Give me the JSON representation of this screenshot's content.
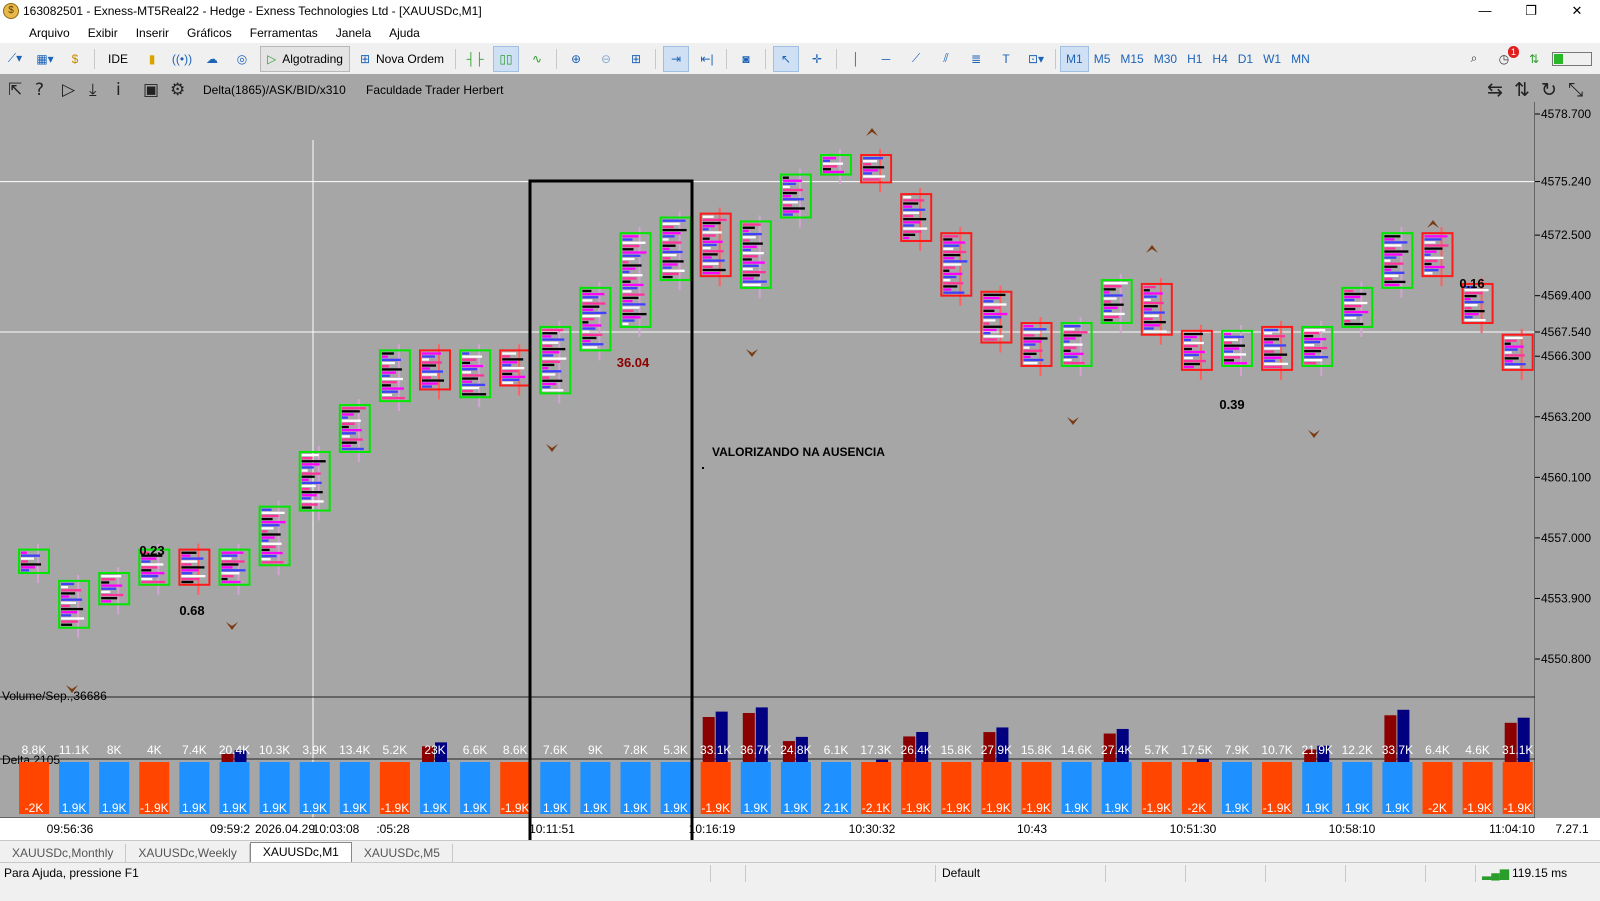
{
  "window": {
    "title": "163082501 - Exness-MT5Real22 - Hedge - Exness Technologies Ltd - [XAUUSDc,M1]",
    "min": "—",
    "max": "❐",
    "close": "✕"
  },
  "menu": [
    "Arquivo",
    "Exibir",
    "Inserir",
    "Gráficos",
    "Ferramentas",
    "Janela",
    "Ajuda"
  ],
  "toolbar": {
    "ide": "IDE",
    "algotrading": "Algotrading",
    "nova_ordem": "Nova Ordem",
    "timeframes": [
      "M1",
      "M5",
      "M15",
      "M30",
      "H1",
      "H4",
      "D1",
      "W1",
      "MN"
    ],
    "active_timeframe": "M1",
    "notif_count": "1"
  },
  "chart": {
    "indicator_label": "Delta(1865)/ASK/BID/x310",
    "owner_label": "Faculdade Trader Herbert",
    "prices": [
      "4578.700",
      "4575.240",
      "4572.500",
      "4569.400",
      "4567.540",
      "4566.300",
      "4563.200",
      "4560.100",
      "4557.000",
      "4553.900",
      "4550.800"
    ],
    "annotation": "VALORIZANDO NA AUSENCIA",
    "small_values": [
      "0.23",
      "0.68",
      "36.04",
      "0.39",
      "0.16"
    ],
    "volume_label": "Volume/Sep.,36686",
    "delta_label": "Delta,2105",
    "volume_values": [
      "8.8K",
      "11.1K",
      "8K",
      "4K",
      "7.4K",
      "20.4K",
      "10.3K",
      "3.9K",
      "13.4K",
      "5.2K",
      "23K",
      "6.6K",
      "8.6K",
      "7.6K",
      "9K",
      "7.8K",
      "5.3K",
      "33.1K",
      "36.7K",
      "24.8K",
      "6.1K",
      "17.3K",
      "26.4K",
      "15.8K",
      "27.9K",
      "15.8K",
      "14.6K",
      "27.4K",
      "5.7K",
      "17.5K",
      "7.9K",
      "10.7K",
      "21.9K",
      "12.2K",
      "33.7K",
      "6.4K",
      "4.6K",
      "31.1K"
    ],
    "delta_values": [
      "-2K",
      "1.9K",
      "1.9K",
      "-1.9K",
      "1.9K",
      "1.9K",
      "1.9K",
      "1.9K",
      "1.9K",
      "-1.9K",
      "1.9K",
      "1.9K",
      "-1.9K",
      "1.9K",
      "1.9K",
      "1.9K",
      "1.9K",
      "-1.9K",
      "1.9K",
      "1.9K",
      "2.1K",
      "-2.1K",
      "-1.9K",
      "-1.9K",
      "-1.9K",
      "-1.9K",
      "1.9K",
      "1.9K",
      "-1.9K",
      "-2K",
      "1.9K",
      "-1.9K",
      "1.9K",
      "1.9K",
      "1.9K",
      "-2K",
      "-1.9K",
      "-1.9K"
    ],
    "times": [
      "09:56:36",
      "09:59:2",
      "2026.04.29",
      "10:03:08",
      ":05:28",
      "10:11:51",
      "10:16:19",
      "10:30:32",
      "10:43",
      "10:51:30",
      "10:58:10",
      "11:04:10"
    ],
    "version": "7.27.1",
    "colors": {
      "background": "#a6a6a6",
      "bull": "#00e600",
      "bear": "#ff1a1a",
      "ask": "#1e90ff",
      "bid": "#ff4500",
      "vol_bear": "#8b0000",
      "vol_bull": "#000080",
      "arrow": "#7a3b12"
    }
  },
  "tabs": [
    "XAUUSDc,Monthly",
    "XAUUSDc,Weekly",
    "XAUUSDc,M1",
    "XAUUSDc,M5"
  ],
  "active_tab": "XAUUSDc,M1",
  "status": {
    "help": "Para Ajuda, pressione F1",
    "profile": "Default",
    "ping": "119.15 ms"
  }
}
